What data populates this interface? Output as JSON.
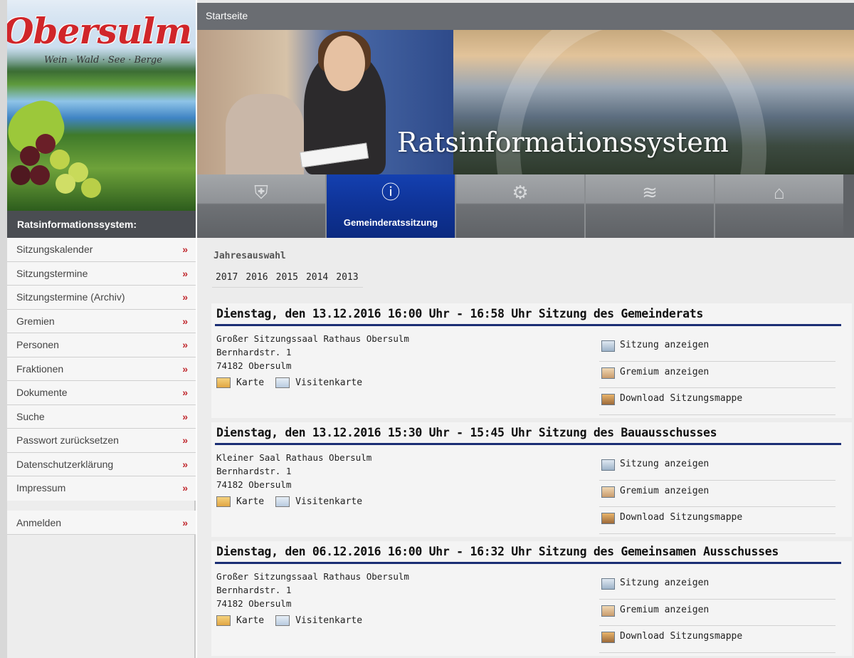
{
  "logo": {
    "wordmark": "Obersulm",
    "tagline": "Wein · Wald · See · Berge"
  },
  "topbar": {
    "link": "Startseite"
  },
  "banner": {
    "title": "Ratsinformationssystem"
  },
  "sidebar": {
    "header": "Ratsinformationssystem:",
    "chevron": "»",
    "items": [
      {
        "label": "Sitzungskalender"
      },
      {
        "label": "Sitzungstermine"
      },
      {
        "label": "Sitzungstermine (Archiv)"
      },
      {
        "label": "Gremien"
      },
      {
        "label": "Personen"
      },
      {
        "label": "Fraktionen"
      },
      {
        "label": "Dokumente"
      },
      {
        "label": "Suche"
      },
      {
        "label": "Passwort zurücksetzen"
      },
      {
        "label": "Datenschutzerklärung"
      },
      {
        "label": "Impressum"
      }
    ],
    "login": "Anmelden"
  },
  "tabs": [
    {
      "icon": "coat-of-arms-icon",
      "glyph": "⛨",
      "label": ""
    },
    {
      "icon": "info-icon",
      "glyph": "ⓘ",
      "label": "Gemeinderatssitzung",
      "active": true
    },
    {
      "icon": "gear-icon",
      "glyph": "⚙",
      "label": ""
    },
    {
      "icon": "water-waves-icon",
      "glyph": "≋",
      "label": ""
    },
    {
      "icon": "factory-icon",
      "glyph": "⌂",
      "label": ""
    }
  ],
  "main": {
    "year_heading": "Jahresauswahl",
    "years": [
      "2017",
      "2016",
      "2015",
      "2014",
      "2013"
    ],
    "meetings": [
      {
        "title": "Dienstag, den 13.12.2016 16:00 Uhr - 16:58 Uhr Sitzung des Gemeinderats",
        "location": "Großer Sitzungssaal Rathaus Obersulm",
        "street": "Bernhardstr. 1",
        "city": "74182 Obersulm",
        "map_link": "Karte",
        "card_link": "Visitenkarte",
        "actions": [
          "Sitzung anzeigen",
          "Gremium anzeigen",
          "Download Sitzungsmappe"
        ]
      },
      {
        "title": "Dienstag, den 13.12.2016 15:30 Uhr - 15:45 Uhr Sitzung des Bauausschusses",
        "location": "Kleiner Saal Rathaus Obersulm",
        "street": "Bernhardstr. 1",
        "city": "74182 Obersulm",
        "map_link": "Karte",
        "card_link": "Visitenkarte",
        "actions": [
          "Sitzung anzeigen",
          "Gremium anzeigen",
          "Download Sitzungsmappe"
        ]
      },
      {
        "title": "Dienstag, den 06.12.2016 16:00 Uhr - 16:32 Uhr Sitzung des Gemeinsamen Ausschusses",
        "location": "Großer Sitzungssaal Rathaus Obersulm",
        "street": "Bernhardstr. 1",
        "city": "74182 Obersulm",
        "map_link": "Karte",
        "card_link": "Visitenkarte",
        "actions": [
          "Sitzung anzeigen",
          "Gremium anzeigen",
          "Download Sitzungsmappe"
        ]
      }
    ]
  },
  "colors": {
    "accent_blue": "#1b2e74",
    "active_tab": "#0f3499",
    "chevron_red": "#c0272d",
    "logo_red": "#d0262a"
  }
}
